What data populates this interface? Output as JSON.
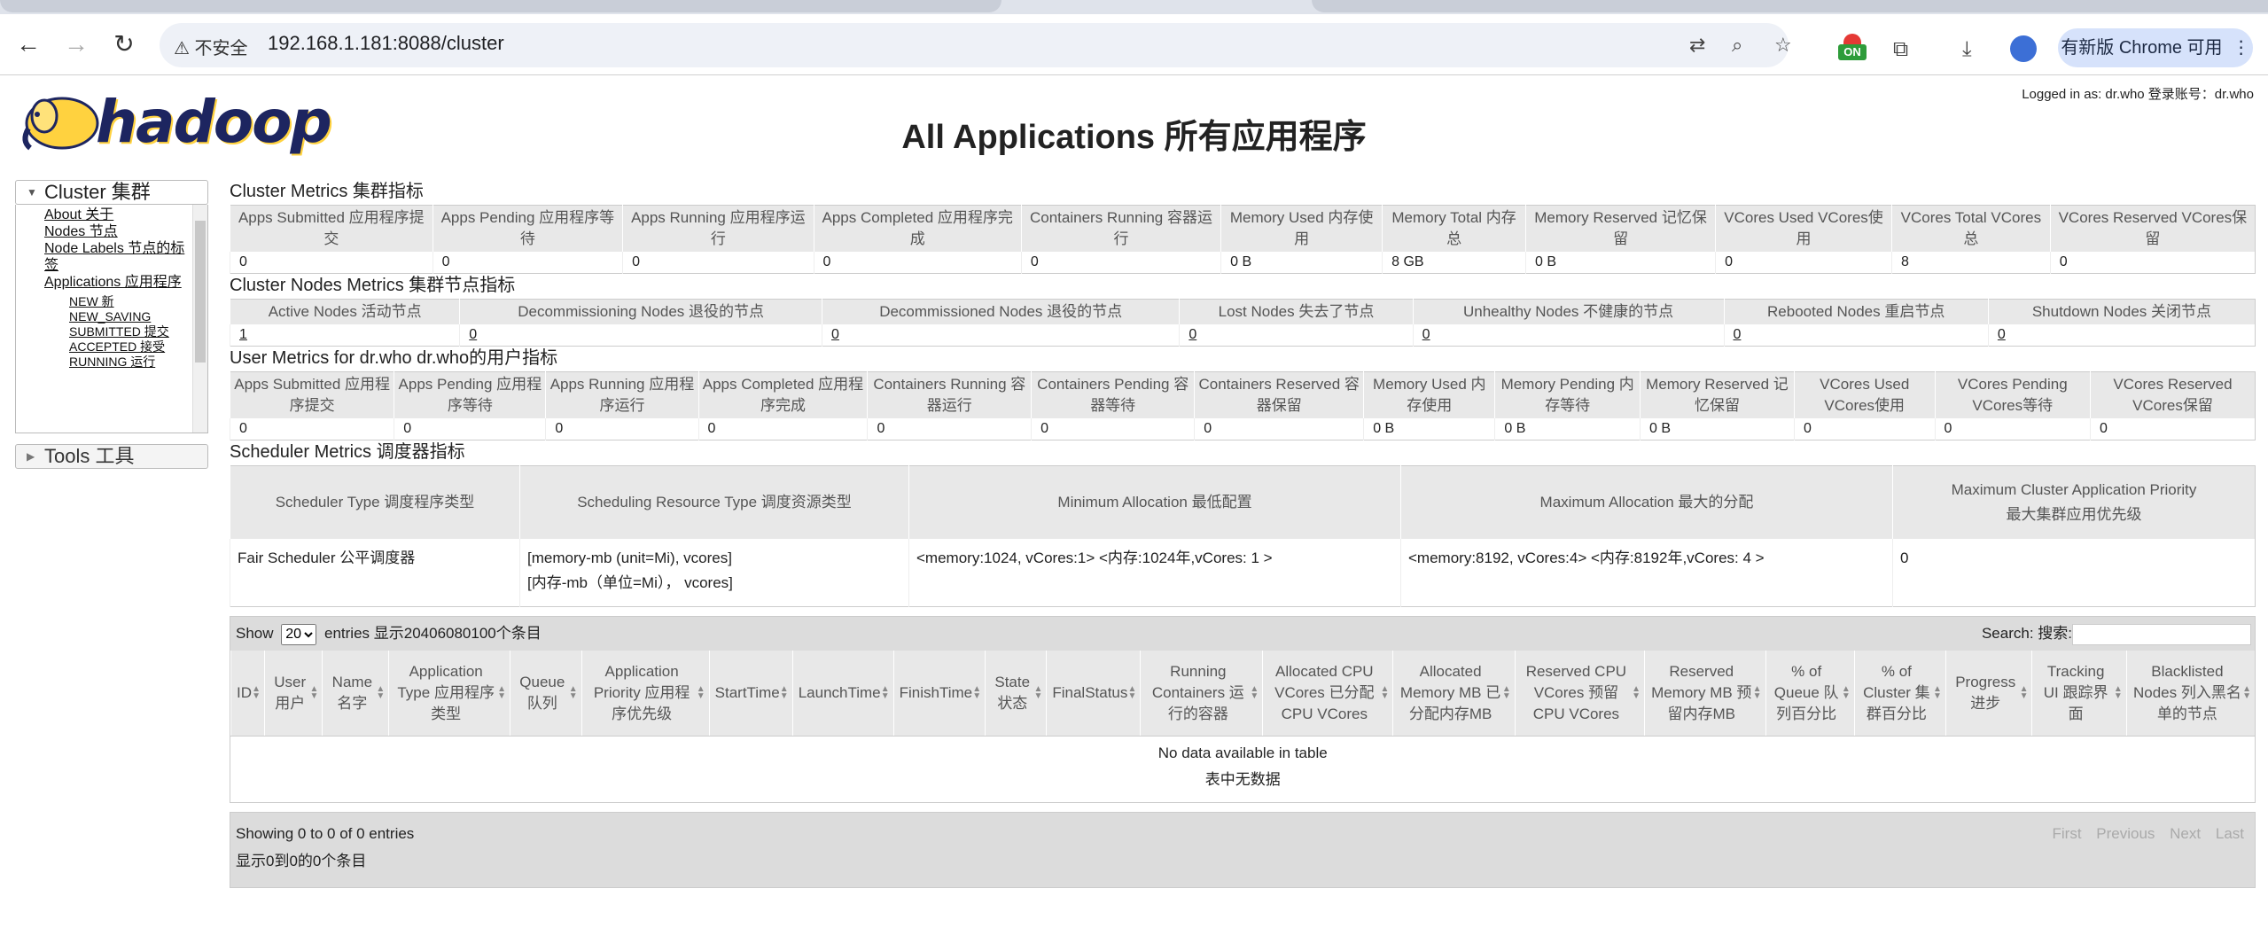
{
  "browser": {
    "insecure_label": "不安全",
    "url": "192.168.1.181:8088/cluster",
    "ext_badge": "ON",
    "update_label": "有新版 Chrome 可用"
  },
  "header": {
    "logo_text": "hadoop",
    "title": "All Applications 所有应用程序",
    "logged_in": "Logged in as: dr.who 登录账号：dr.who"
  },
  "sidebar": {
    "cluster_label": "Cluster 集群",
    "links": [
      "About 关于",
      "Nodes 节点",
      "Node Labels 节点的标签",
      "Applications 应用程序"
    ],
    "sub_links": [
      "NEW 新",
      "NEW_SAVING",
      "SUBMITTED 提交",
      "ACCEPTED 接受",
      "RUNNING 运行"
    ],
    "tools_label": "Tools 工具"
  },
  "cluster_metrics": {
    "title": "Cluster Metrics 集群指标",
    "headers": [
      "Apps Submitted 应用程序提交",
      "Apps Pending 应用程序等待",
      "Apps Running 应用程序运行",
      "Apps Completed 应用程序完成",
      "Containers Running 容器运行",
      "Memory Used 内存使用",
      "Memory Total 内存总",
      "Memory Reserved 记忆保留",
      "VCores Used VCores使用",
      "VCores Total VCores总",
      "VCores Reserved VCores保留"
    ],
    "values": [
      "0",
      "0",
      "0",
      "0",
      "0",
      "0 B",
      "8 GB",
      "0 B",
      "0",
      "8",
      "0"
    ]
  },
  "node_metrics": {
    "title": "Cluster Nodes Metrics 集群节点指标",
    "headers": [
      "Active Nodes 活动节点",
      "Decommissioning Nodes 退役的节点",
      "Decommissioned Nodes 退役的节点",
      "Lost Nodes 失去了节点",
      "Unhealthy Nodes 不健康的节点",
      "Rebooted Nodes 重启节点",
      "Shutdown Nodes 关闭节点"
    ],
    "values": [
      "1",
      "0",
      "0",
      "0",
      "0",
      "0",
      "0"
    ]
  },
  "user_metrics": {
    "title": "User Metrics for dr.who dr.who的用户指标",
    "headers": [
      "Apps Submitted 应用程序提交",
      "Apps Pending 应用程序等待",
      "Apps Running 应用程序运行",
      "Apps Completed 应用程序完成",
      "Containers Running 容器运行",
      "Containers Pending 容器等待",
      "Containers Reserved 容器保留",
      "Memory Used 内存使用",
      "Memory Pending 内存等待",
      "Memory Reserved 记忆保留",
      "VCores Used VCores使用",
      "VCores Pending VCores等待",
      "VCores Reserved VCores保留"
    ],
    "values": [
      "0",
      "0",
      "0",
      "0",
      "0",
      "0",
      "0",
      "0 B",
      "0 B",
      "0 B",
      "0",
      "0",
      "0"
    ]
  },
  "scheduler_metrics": {
    "title": "Scheduler Metrics 调度器指标",
    "headers": [
      "Scheduler Type 调度程序类型",
      "Scheduling Resource Type 调度资源类型",
      "Minimum Allocation 最低配置",
      "Maximum Allocation 最大的分配",
      "Maximum Cluster Application Priority",
      "最大集群应用优先级"
    ],
    "row": {
      "type": "Fair Scheduler 公平调度器",
      "resource_1": "[memory-mb (unit=Mi), vcores]",
      "resource_2": "[内存-mb（单位=Mi）， vcores]",
      "min_alloc": "<memory:1024, vCores:1> <内存:1024年,vCores: 1 >",
      "max_alloc": "<memory:8192, vCores:4> <内存:8192年,vCores: 4 >",
      "priority": "0"
    }
  },
  "apps_table": {
    "show_label": "Show",
    "page_size": "20",
    "entries_label": "entries 显示20406080100个条目",
    "search_label": "Search: 搜索:",
    "headers": [
      "ID",
      "User 用户",
      "Name 名字",
      "Application Type 应用程序类型",
      "Queue 队列",
      "Application Priority 应用程序优先级",
      "StartTime",
      "LaunchTime",
      "FinishTime",
      "State 状态",
      "FinalStatus",
      "Running Containers 运行的容器",
      "Allocated CPU VCores 已分配CPU VCores",
      "Allocated Memory MB 已分配内存MB",
      "Reserved CPU VCores 预留CPU VCores",
      "Reserved Memory MB 预留内存MB",
      "% of Queue 队列百分比",
      "% of Cluster 集群百分比",
      "Progress 进步",
      "Tracking UI 跟踪界面",
      "Blacklisted Nodes 列入黑名单的节点"
    ],
    "empty_1": "No data available in table",
    "empty_2": "表中无数据",
    "info_1": "Showing 0 to 0 of 0 entries",
    "info_2": "显示0到0的0个条目",
    "pager": [
      "First",
      "Previous",
      "Next",
      "Last"
    ]
  }
}
